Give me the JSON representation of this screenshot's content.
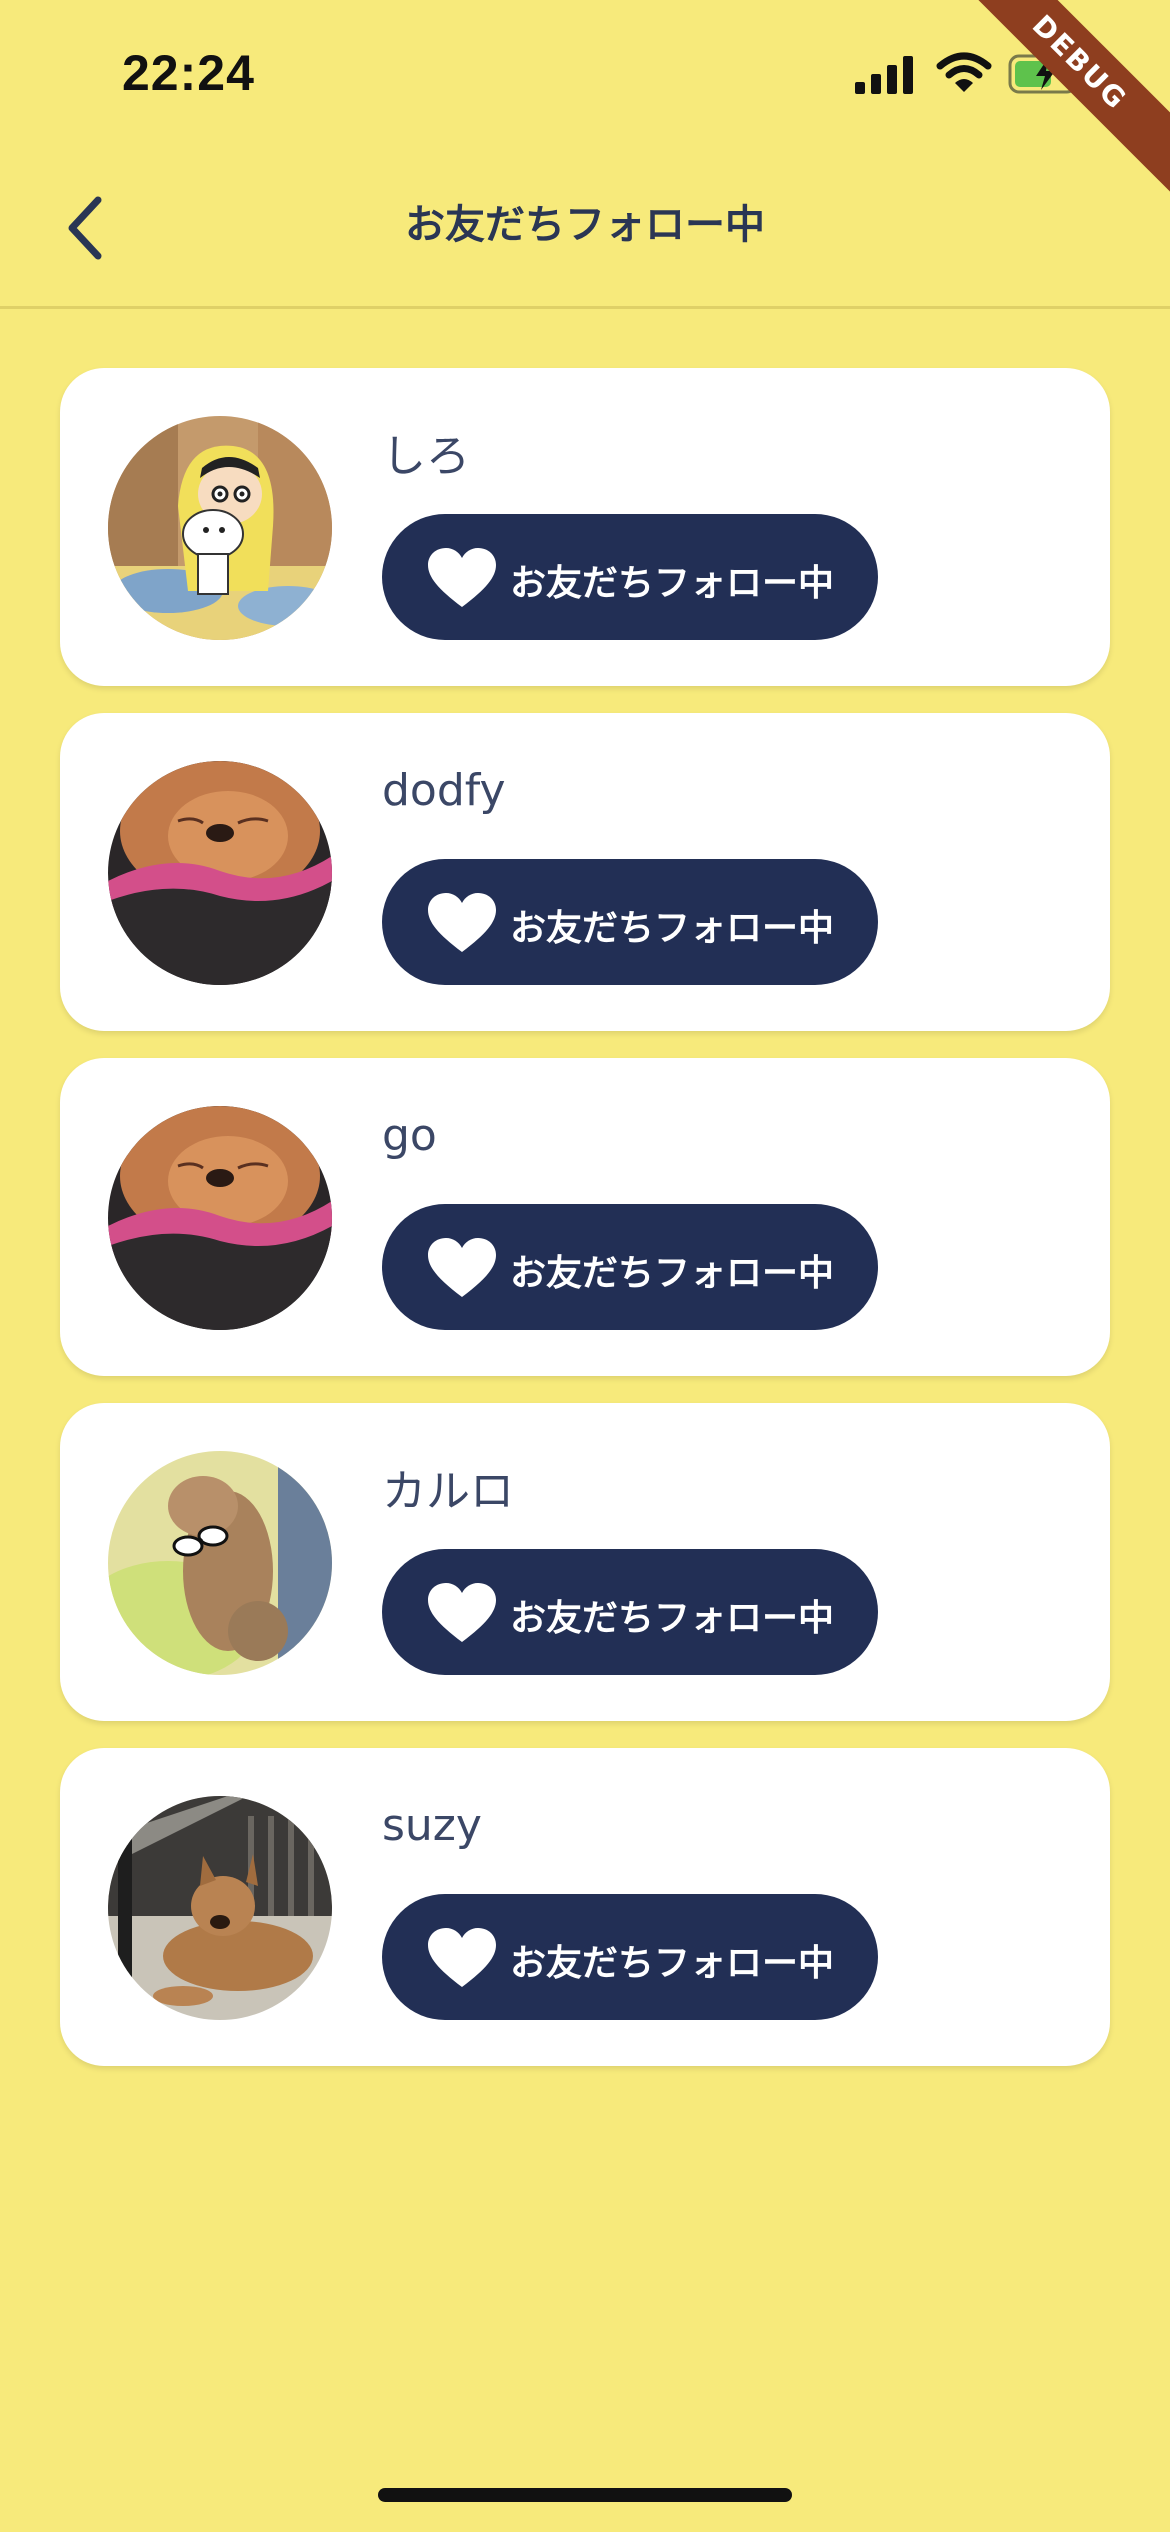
{
  "status_bar": {
    "time": "22:24"
  },
  "debug_banner": "DEBUG",
  "appbar": {
    "title": "お友だちフォロー中"
  },
  "friends": [
    {
      "name": "しろ",
      "button_label": "お友だちフォロー中",
      "avatar": "cartoon-boy-with-white-dog"
    },
    {
      "name": "dodfy",
      "button_label": "お友だちフォロー中",
      "avatar": "sleeping-dog-in-blanket"
    },
    {
      "name": "go",
      "button_label": "お友だちフォロー中",
      "avatar": "sleeping-dog-in-blanket"
    },
    {
      "name": "カルロ",
      "button_label": "お友だちフォロー中",
      "avatar": "dog-with-sunglasses"
    },
    {
      "name": "suzy",
      "button_label": "お友だちフォロー中",
      "avatar": "dog-lying-on-step"
    }
  ],
  "colors": {
    "background": "#f7ea7b",
    "button": "#222f55",
    "card": "#ffffff",
    "text": "#2a3654"
  }
}
